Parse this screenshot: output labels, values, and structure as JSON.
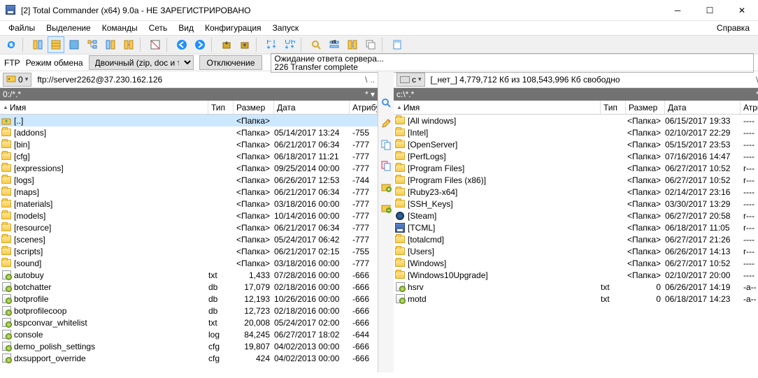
{
  "window": {
    "title": "[2] Total Commander (x64) 9.0a - НЕ ЗАРЕГИСТРИРОВАНО"
  },
  "menu": {
    "items": [
      "Файлы",
      "Выделение",
      "Команды",
      "Сеть",
      "Вид",
      "Конфигурация",
      "Запуск"
    ],
    "right": "Справка"
  },
  "ftp": {
    "label_ftp": "FTP",
    "label_mode": "Режим обмена",
    "mode_value": "Двоичный (zip, doc и т.д.)",
    "disconnect": "Отключение",
    "status1": "Ожидание ответа сервера...",
    "status2": "226 Transfer complete"
  },
  "left": {
    "drive_label": "0",
    "address": "ftp://server2262@37.230.162.126",
    "path": "0:/*.*",
    "headers": {
      "name": "Имя",
      "type": "Тип",
      "size": "Размер",
      "date": "Дата",
      "attr": "Атрибу"
    },
    "rows": [
      {
        "icon": "up",
        "name": "[..]",
        "type": "",
        "size": "<Папка>",
        "date": "",
        "attr": "",
        "sel": true
      },
      {
        "icon": "fld",
        "name": "[addons]",
        "type": "",
        "size": "<Папка>",
        "date": "05/14/2017 13:24",
        "attr": "-755"
      },
      {
        "icon": "fld",
        "name": "[bin]",
        "type": "",
        "size": "<Папка>",
        "date": "06/21/2017 06:34",
        "attr": "-777"
      },
      {
        "icon": "fld",
        "name": "[cfg]",
        "type": "",
        "size": "<Папка>",
        "date": "06/18/2017 11:21",
        "attr": "-777"
      },
      {
        "icon": "fld",
        "name": "[expressions]",
        "type": "",
        "size": "<Папка>",
        "date": "09/25/2014 00:00",
        "attr": "-777"
      },
      {
        "icon": "fld",
        "name": "[logs]",
        "type": "",
        "size": "<Папка>",
        "date": "06/26/2017 12:53",
        "attr": "-744"
      },
      {
        "icon": "fld",
        "name": "[maps]",
        "type": "",
        "size": "<Папка>",
        "date": "06/21/2017 06:34",
        "attr": "-777"
      },
      {
        "icon": "fld",
        "name": "[materials]",
        "type": "",
        "size": "<Папка>",
        "date": "03/18/2016 00:00",
        "attr": "-777"
      },
      {
        "icon": "fld",
        "name": "[models]",
        "type": "",
        "size": "<Папка>",
        "date": "10/14/2016 00:00",
        "attr": "-777"
      },
      {
        "icon": "fld",
        "name": "[resource]",
        "type": "",
        "size": "<Папка>",
        "date": "06/21/2017 06:34",
        "attr": "-777"
      },
      {
        "icon": "fld",
        "name": "[scenes]",
        "type": "",
        "size": "<Папка>",
        "date": "05/24/2017 06:42",
        "attr": "-777"
      },
      {
        "icon": "fld",
        "name": "[scripts]",
        "type": "",
        "size": "<Папка>",
        "date": "06/21/2017 02:15",
        "attr": "-755"
      },
      {
        "icon": "fld",
        "name": "[sound]",
        "type": "",
        "size": "<Папка>",
        "date": "03/18/2016 00:00",
        "attr": "-777"
      },
      {
        "icon": "cfg",
        "name": "autobuy",
        "type": "txt",
        "size": "1,433",
        "date": "07/28/2016 00:00",
        "attr": "-666"
      },
      {
        "icon": "cfg",
        "name": "botchatter",
        "type": "db",
        "size": "17,079",
        "date": "02/18/2016 00:00",
        "attr": "-666"
      },
      {
        "icon": "cfg",
        "name": "botprofile",
        "type": "db",
        "size": "12,193",
        "date": "10/26/2016 00:00",
        "attr": "-666"
      },
      {
        "icon": "cfg",
        "name": "botprofilecoop",
        "type": "db",
        "size": "12,723",
        "date": "02/18/2016 00:00",
        "attr": "-666"
      },
      {
        "icon": "cfg",
        "name": "bspconvar_whitelist",
        "type": "txt",
        "size": "20,008",
        "date": "05/24/2017 02:00",
        "attr": "-666"
      },
      {
        "icon": "cfg",
        "name": "console",
        "type": "log",
        "size": "84,245",
        "date": "06/27/2017 18:02",
        "attr": "-644"
      },
      {
        "icon": "cfg",
        "name": "demo_polish_settings",
        "type": "cfg",
        "size": "19,807",
        "date": "04/02/2013 00:00",
        "attr": "-666"
      },
      {
        "icon": "cfg",
        "name": "dxsupport_override",
        "type": "cfg",
        "size": "424",
        "date": "04/02/2013 00:00",
        "attr": "-666"
      }
    ]
  },
  "right": {
    "drive_label": "c",
    "free_text": "[_нет_]  4,779,712 Кб из 108,543,996 Кб свободно",
    "path": "c:\\*.*",
    "headers": {
      "name": "Имя",
      "type": "Тип",
      "size": "Размер",
      "date": "Дата",
      "attr": "Атрибу"
    },
    "rows": [
      {
        "icon": "fld",
        "name": "[All windows]",
        "type": "",
        "size": "<Папка>",
        "date": "06/15/2017 19:33",
        "attr": "----"
      },
      {
        "icon": "fld",
        "name": "[Intel]",
        "type": "",
        "size": "<Папка>",
        "date": "02/10/2017 22:29",
        "attr": "----"
      },
      {
        "icon": "fld",
        "name": "[OpenServer]",
        "type": "",
        "size": "<Папка>",
        "date": "05/15/2017 23:53",
        "attr": "----"
      },
      {
        "icon": "fld",
        "name": "[PerfLogs]",
        "type": "",
        "size": "<Папка>",
        "date": "07/16/2016 14:47",
        "attr": "----"
      },
      {
        "icon": "fld",
        "name": "[Program Files]",
        "type": "",
        "size": "<Папка>",
        "date": "06/27/2017 10:52",
        "attr": "r---"
      },
      {
        "icon": "fld",
        "name": "[Program Files (x86)]",
        "type": "",
        "size": "<Папка>",
        "date": "06/27/2017 10:52",
        "attr": "r---"
      },
      {
        "icon": "fld",
        "name": "[Ruby23-x64]",
        "type": "",
        "size": "<Папка>",
        "date": "02/14/2017 23:16",
        "attr": "----"
      },
      {
        "icon": "fld",
        "name": "[SSH_Keys]",
        "type": "",
        "size": "<Папка>",
        "date": "03/30/2017 13:29",
        "attr": "----"
      },
      {
        "icon": "steam",
        "name": "[Steam]",
        "type": "",
        "size": "<Папка>",
        "date": "06/27/2017 20:58",
        "attr": "r---"
      },
      {
        "icon": "disk",
        "name": "[TCML]",
        "type": "",
        "size": "<Папка>",
        "date": "06/18/2017 11:05",
        "attr": "r---"
      },
      {
        "icon": "fld",
        "name": "[totalcmd]",
        "type": "",
        "size": "<Папка>",
        "date": "06/27/2017 21:26",
        "attr": "----"
      },
      {
        "icon": "fld",
        "name": "[Users]",
        "type": "",
        "size": "<Папка>",
        "date": "06/26/2017 14:13",
        "attr": "r---"
      },
      {
        "icon": "fld",
        "name": "[Windows]",
        "type": "",
        "size": "<Папка>",
        "date": "06/27/2017 10:52",
        "attr": "----"
      },
      {
        "icon": "fld",
        "name": "[Windows10Upgrade]",
        "type": "",
        "size": "<Папка>",
        "date": "02/10/2017 20:00",
        "attr": "----"
      },
      {
        "icon": "cfg",
        "name": "hsrv",
        "type": "txt",
        "size": "0",
        "date": "06/26/2017 14:19",
        "attr": "-a--"
      },
      {
        "icon": "cfg",
        "name": "motd",
        "type": "txt",
        "size": "0",
        "date": "06/18/2017 14:23",
        "attr": "-a--"
      }
    ]
  }
}
